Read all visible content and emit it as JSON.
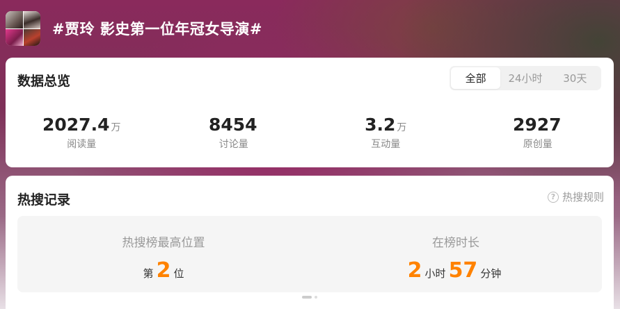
{
  "header": {
    "title": "#贾玲 影史第一位年冠女导演#"
  },
  "overview": {
    "title": "数据总览",
    "tabs": [
      "全部",
      "24小时",
      "30天"
    ],
    "active_tab": "全部",
    "stats": [
      {
        "value": "2027.4",
        "unit": "万",
        "label": "阅读量"
      },
      {
        "value": "8454",
        "unit": "",
        "label": "讨论量"
      },
      {
        "value": "3.2",
        "unit": "万",
        "label": "互动量"
      },
      {
        "value": "2927",
        "unit": "",
        "label": "原创量"
      }
    ]
  },
  "hot_search": {
    "title": "热搜记录",
    "rules_label": "热搜规则",
    "peak": {
      "label": "热搜榜最高位置",
      "prefix": "第",
      "value": "2",
      "suffix": "位"
    },
    "duration": {
      "label": "在榜时长",
      "hours": "2",
      "hours_unit": "小时",
      "minutes": "57",
      "minutes_unit": "分钟"
    }
  },
  "colors": {
    "accent": "#ff8200",
    "card_bg": "#ffffff",
    "inner_bg": "#f5f5f5"
  },
  "icons": {
    "help": "question-circle-icon"
  }
}
